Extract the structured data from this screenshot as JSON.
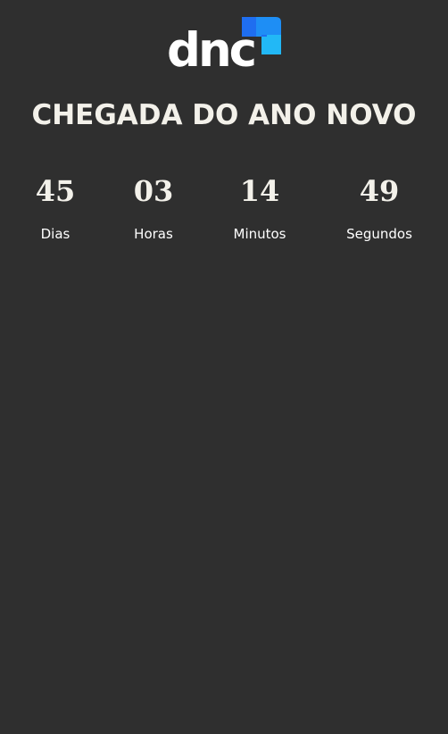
{
  "logo": {
    "text": "dnc",
    "colors": {
      "text": "#ffffff",
      "dark_blue": "#1f6ef0",
      "light_blue": "#22b8f6"
    }
  },
  "header": {
    "title": "CHEGADA DO ANO NOVO"
  },
  "countdown": {
    "units": [
      {
        "value": "45",
        "label": "Dias"
      },
      {
        "value": "03",
        "label": "Horas"
      },
      {
        "value": "14",
        "label": "Minutos"
      },
      {
        "value": "49",
        "label": "Segundos"
      }
    ]
  },
  "colors": {
    "background": "#2f2f2f",
    "text": "#f3f1ea"
  }
}
